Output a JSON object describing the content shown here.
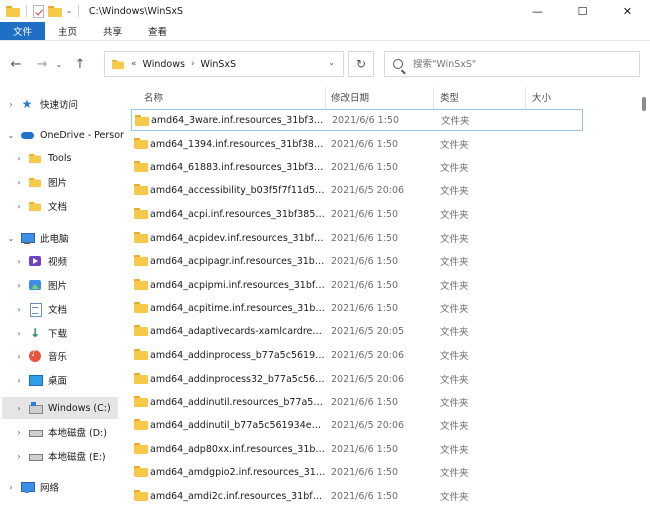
{
  "window": {
    "title": "C:\\Windows\\WinSxS",
    "minimize": "—",
    "maximize": "☐",
    "close": "✕"
  },
  "ribbon": {
    "tabs": [
      "文件",
      "主页",
      "共享",
      "查看"
    ],
    "active_tab": "文件",
    "expand_glyph": "⌄",
    "help_glyph": "?"
  },
  "nav": {
    "back": "←",
    "forward": "→",
    "dropdown": "⌄",
    "up": "↑",
    "refresh": "↻"
  },
  "address": {
    "prefix": "«",
    "crumbs": [
      "Windows",
      "WinSxS"
    ],
    "separator": "›"
  },
  "search": {
    "placeholder": "搜索\"WinSxS\""
  },
  "sidebar": {
    "items": [
      {
        "label": "快速访问",
        "icon": "star-icon",
        "chevron": "›"
      },
      {
        "label": "OneDrive - Persor",
        "icon": "cloud-icon",
        "chevron": "⌄"
      },
      {
        "label": "Tools",
        "icon": "folder-icon",
        "chevron": "›"
      },
      {
        "label": "图片",
        "icon": "folder-icon",
        "chevron": "›"
      },
      {
        "label": "文档",
        "icon": "folder-icon",
        "chevron": "›"
      },
      {
        "label": "此电脑",
        "icon": "computer-icon",
        "chevron": "⌄"
      },
      {
        "label": "视频",
        "icon": "videos-icon",
        "chevron": "›"
      },
      {
        "label": "图片",
        "icon": "pictures-icon",
        "chevron": "›"
      },
      {
        "label": "文档",
        "icon": "documents-icon",
        "chevron": "›"
      },
      {
        "label": "下载",
        "icon": "downloads-icon",
        "chevron": "›"
      },
      {
        "label": "音乐",
        "icon": "music-icon",
        "chevron": "›"
      },
      {
        "label": "桌面",
        "icon": "desktop-icon",
        "chevron": "›"
      },
      {
        "label": "Windows (C:)",
        "icon": "windows-drive-icon",
        "chevron": "›"
      },
      {
        "label": "本地磁盘 (D:)",
        "icon": "drive-icon",
        "chevron": "›"
      },
      {
        "label": "本地磁盘 (E:)",
        "icon": "drive-icon",
        "chevron": "›"
      },
      {
        "label": "网络",
        "icon": "network-icon",
        "chevron": "›"
      }
    ],
    "selected": "Windows (C:)"
  },
  "columns": {
    "name": "名称",
    "date": "修改日期",
    "type": "类型",
    "size": "大小"
  },
  "files": [
    {
      "name": "amd64_3ware.inf.resources_31bf3856...",
      "date": "2021/6/6 1:50",
      "type": "文件夹"
    },
    {
      "name": "amd64_1394.inf.resources_31bf3856a...",
      "date": "2021/6/6 1:50",
      "type": "文件夹"
    },
    {
      "name": "amd64_61883.inf.resources_31bf3856...",
      "date": "2021/6/6 1:50",
      "type": "文件夹"
    },
    {
      "name": "amd64_accessibility_b03f5f7f11d50a3...",
      "date": "2021/6/5 20:06",
      "type": "文件夹"
    },
    {
      "name": "amd64_acpi.inf.resources_31bf3856a...",
      "date": "2021/6/6 1:50",
      "type": "文件夹"
    },
    {
      "name": "amd64_acpidev.inf.resources_31bf38...",
      "date": "2021/6/6 1:50",
      "type": "文件夹"
    },
    {
      "name": "amd64_acpipagr.inf.resources_31bf3...",
      "date": "2021/6/6 1:50",
      "type": "文件夹"
    },
    {
      "name": "amd64_acpipmi.inf.resources_31bf38...",
      "date": "2021/6/6 1:50",
      "type": "文件夹"
    },
    {
      "name": "amd64_acpitime.inf.resources_31bf38...",
      "date": "2021/6/6 1:50",
      "type": "文件夹"
    },
    {
      "name": "amd64_adaptivecards-xamlcardrend...",
      "date": "2021/6/5 20:05",
      "type": "文件夹"
    },
    {
      "name": "amd64_addinprocess_b77a5c561934...",
      "date": "2021/6/5 20:06",
      "type": "文件夹"
    },
    {
      "name": "amd64_addinprocess32_b77a5c5619...",
      "date": "2021/6/5 20:06",
      "type": "文件夹"
    },
    {
      "name": "amd64_addinutil.resources_b77a5c56...",
      "date": "2021/6/6 1:50",
      "type": "文件夹"
    },
    {
      "name": "amd64_addinutil_b77a5c561934e089_...",
      "date": "2021/6/5 20:06",
      "type": "文件夹"
    },
    {
      "name": "amd64_adp80xx.inf.resources_31bf38...",
      "date": "2021/6/6 1:50",
      "type": "文件夹"
    },
    {
      "name": "amd64_amdgpio2.inf.resources_31bf...",
      "date": "2021/6/6 1:50",
      "type": "文件夹"
    },
    {
      "name": "amd64_amdi2c.inf.resources_31bf385...",
      "date": "2021/6/6 1:50",
      "type": "文件夹"
    }
  ],
  "colors": {
    "accent": "#1f6fc5",
    "folder": "#f7c948",
    "selection": "#e5e5e5",
    "focus_border": "#99c3ed"
  }
}
